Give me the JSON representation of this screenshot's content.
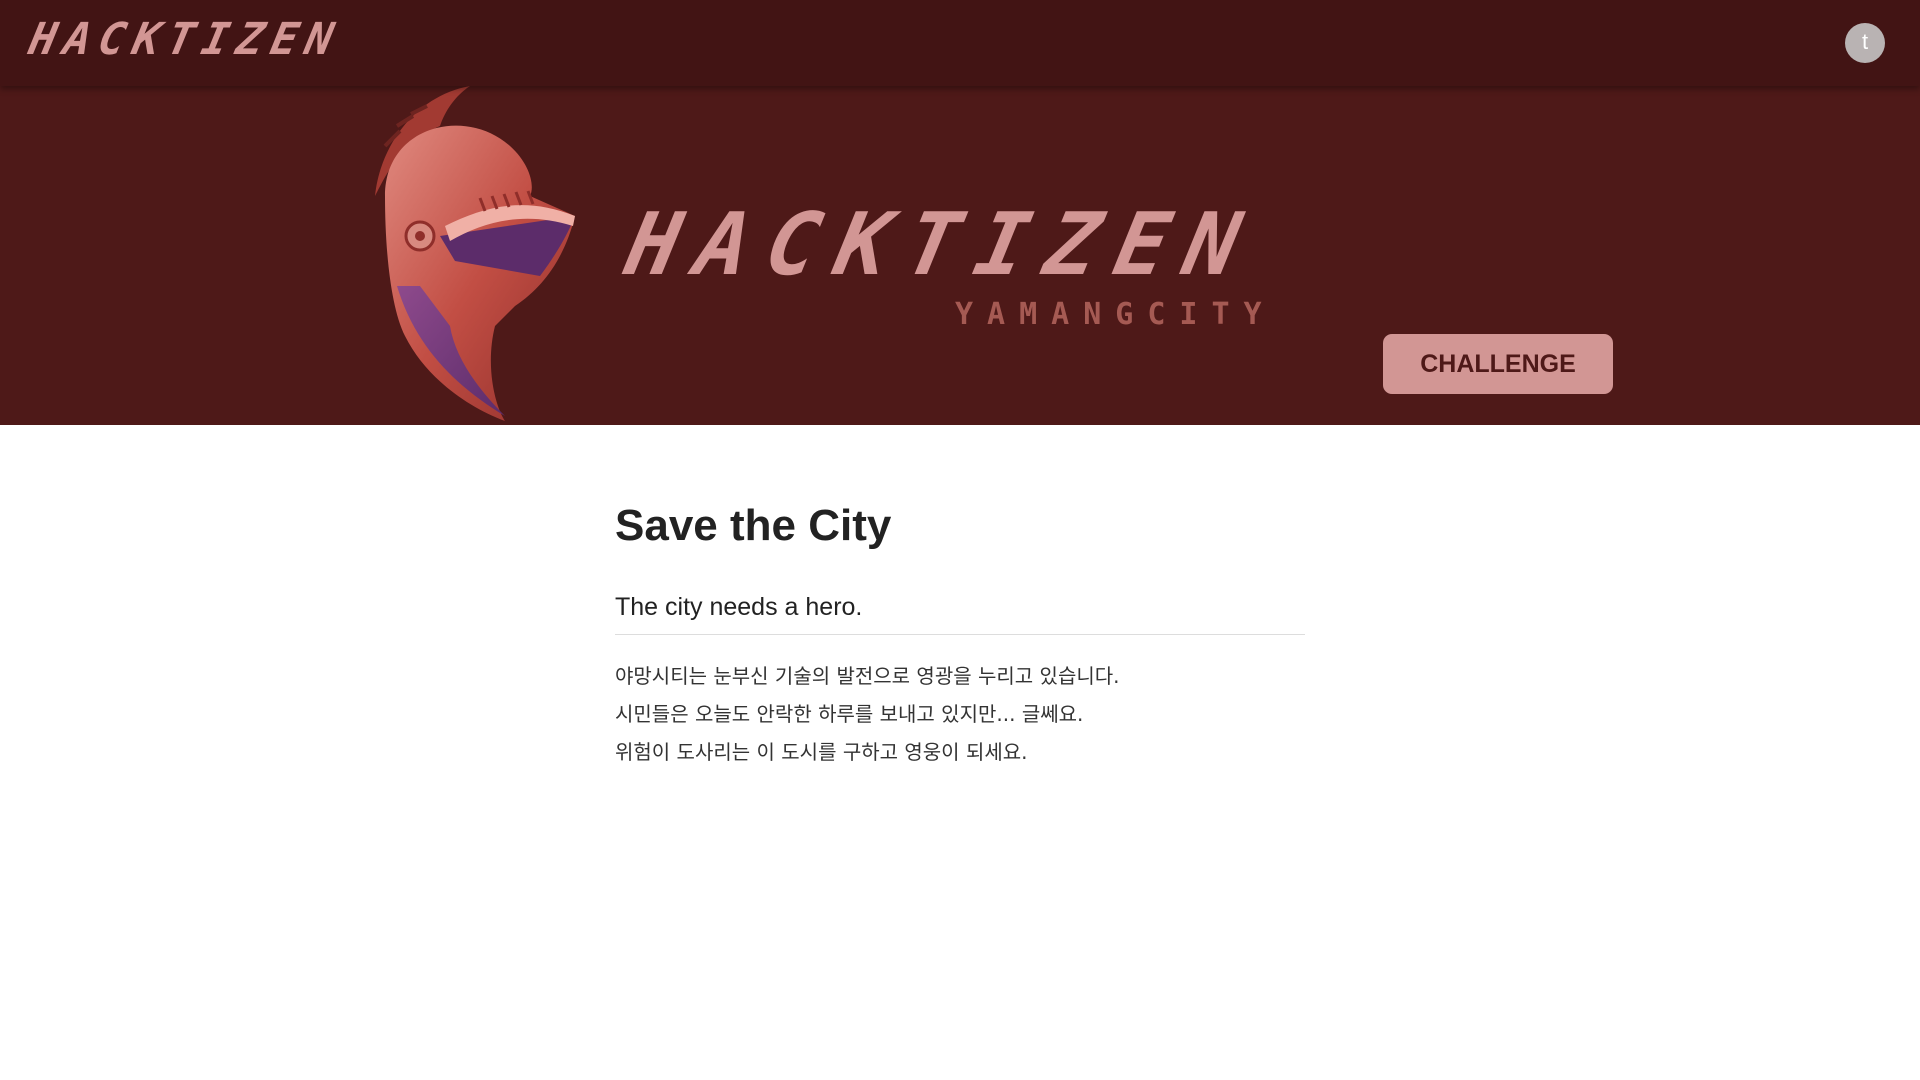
{
  "header": {
    "logo_text": "HACKTIZEN",
    "avatar_initial": "t"
  },
  "hero": {
    "title": "HACKTIZEN",
    "subtitle": "YAMANGCITY",
    "challenge_label": "CHALLENGE"
  },
  "main": {
    "title": "Save the City",
    "lead": "The city needs a hero.",
    "lines": [
      "야망시티는 눈부신 기술의 발전으로 영광을 누리고 있습니다.",
      "시민들은 오늘도 안락한 하루를 보내고 있지만... 글쎄요.",
      "위험이 도사리는 이 도시를 구하고 영웅이 되세요."
    ]
  },
  "colors": {
    "topbar": "#421414",
    "hero_bg": "#4e1918",
    "accent": "#d29694",
    "subtitle": "#a55a53"
  },
  "icons": {
    "helmet": "knight-helmet-icon"
  }
}
